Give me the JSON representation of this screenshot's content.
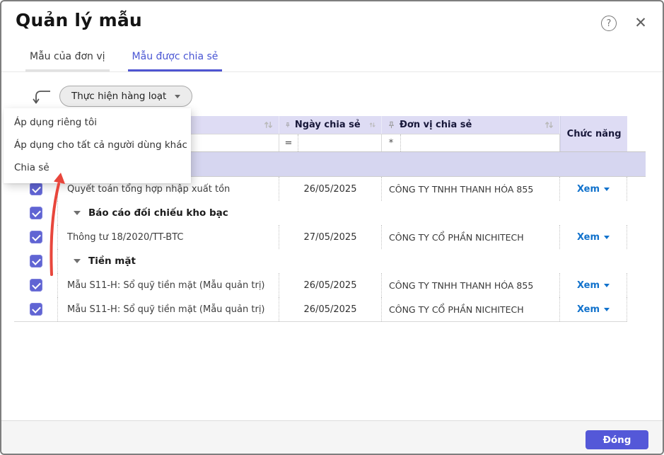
{
  "dialog": {
    "title": "Quản lý mẫu"
  },
  "tabs": [
    {
      "label": "Mẫu của đơn vị",
      "active": false
    },
    {
      "label": "Mẫu được chia sẻ",
      "active": true
    }
  ],
  "toolbar": {
    "bulk_button_label": "Thực hiện hàng loạt"
  },
  "menu": {
    "items": [
      {
        "label": "Áp dụng riêng tôi"
      },
      {
        "label": "Áp dụng cho tất cả người dùng khác"
      },
      {
        "label": "Chia sẻ"
      }
    ]
  },
  "table": {
    "headers": {
      "date": "Ngày chia sẻ",
      "unit": "Đơn vị chia sẻ",
      "actions": "Chức năng"
    },
    "filters": {
      "date_operator": "=",
      "unit_operator": "*"
    },
    "rows": [
      {
        "type": "item",
        "name": "Quyết toán tổng hợp nhập xuất tồn",
        "date": "26/05/2025",
        "unit": "CÔNG TY TNHH THANH HÓA 855",
        "action": "Xem",
        "checked": true
      },
      {
        "type": "group",
        "name": "Báo cáo đối chiếu kho bạc",
        "checked": true
      },
      {
        "type": "item",
        "name": "Thông tư 18/2020/TT-BTC",
        "date": "27/05/2025",
        "unit": "CÔNG TY CỔ PHẦN NICHITECH",
        "action": "Xem",
        "checked": true
      },
      {
        "type": "group",
        "name": "Tiền mặt",
        "checked": true
      },
      {
        "type": "item",
        "name": "Mẫu S11-H: Sổ quỹ tiền mặt (Mẫu quản trị)",
        "date": "26/05/2025",
        "unit": "CÔNG TY TNHH THANH HÓA 855",
        "action": "Xem",
        "checked": true
      },
      {
        "type": "item",
        "name": "Mẫu S11-H: Sổ quỹ tiền mặt (Mẫu quản trị)",
        "date": "26/05/2025",
        "unit": "CÔNG TY CỔ PHẦN NICHITECH",
        "action": "Xem",
        "checked": true
      }
    ]
  },
  "footer": {
    "close_label": "Đóng"
  },
  "colors": {
    "accent": "#4f55d2",
    "checkbox": "#6064d3",
    "header_bg": "#dedcf4",
    "selection_band": "#d6d6f0",
    "link": "#1172cc",
    "annotation_arrow": "#e8463c"
  }
}
